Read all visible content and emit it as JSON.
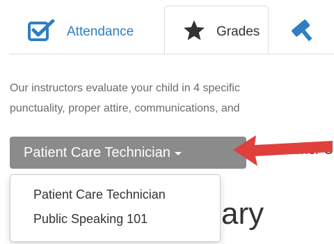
{
  "tabs": [
    {
      "label": "Attendance",
      "icon": "checkbox-icon",
      "active": false
    },
    {
      "label": "Grades",
      "icon": "star-icon",
      "active": true
    },
    {
      "label": "",
      "icon": "gavel-icon",
      "active": false
    }
  ],
  "description": {
    "line1": "Our instructors evaluate your child in 4 specific",
    "line2": "punctuality, proper attire, communications, and"
  },
  "course_selector": {
    "selected": "Patient Care Technician",
    "options": [
      "Patient Care Technician",
      "Public Speaking 101"
    ]
  },
  "partially_hidden": {
    "right_text": "Teacher C",
    "heading_fragment": "ary"
  },
  "colors": {
    "link_blue": "#2f7ec4",
    "button_gray": "#8b8b8b",
    "arrow_red": "#e0403c"
  }
}
